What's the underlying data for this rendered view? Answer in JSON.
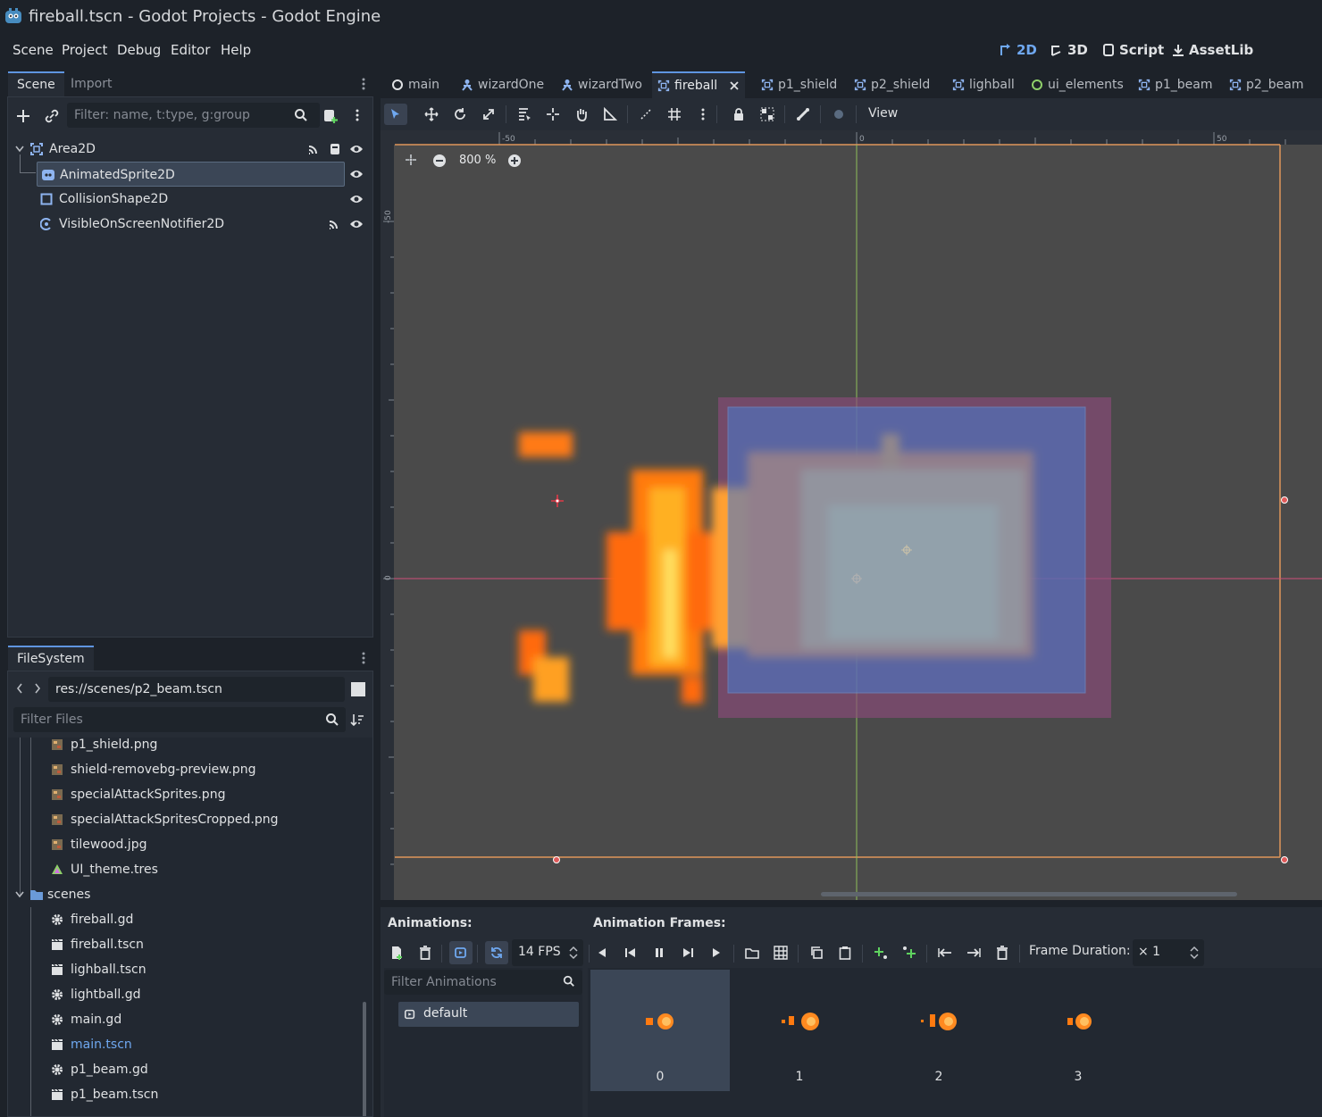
{
  "window": {
    "title": "fireball.tscn - Godot Projects - Godot Engine"
  },
  "menu": {
    "items": [
      "Scene",
      "Project",
      "Debug",
      "Editor",
      "Help"
    ]
  },
  "workspaces": {
    "2d": "2D",
    "3d": "3D",
    "script": "Script",
    "assetlib": "AssetLib"
  },
  "scene_dock": {
    "tabs": [
      "Scene",
      "Import"
    ],
    "filter_placeholder": "Filter: name, t:type, g:group",
    "nodes": [
      {
        "name": "Area2D",
        "icon": "area2d-icon",
        "signals": true,
        "script": true,
        "visible": true
      },
      {
        "name": "AnimatedSprite2D",
        "icon": "animatedsprite-icon",
        "selected": true,
        "visible": true
      },
      {
        "name": "CollisionShape2D",
        "icon": "collisionshape-icon",
        "visible": true
      },
      {
        "name": "VisibleOnScreenNotifier2D",
        "icon": "notifier-icon",
        "signals": true,
        "visible": true
      }
    ]
  },
  "filesystem": {
    "tab": "FileSystem",
    "path": "res://scenes/p2_beam.tscn",
    "filter_placeholder": "Filter Files",
    "items": [
      {
        "name": "p1_shield.png",
        "icon": "image-icon",
        "indent": 1
      },
      {
        "name": "shield-removebg-preview.png",
        "icon": "image-icon",
        "indent": 1
      },
      {
        "name": "specialAttackSprites.png",
        "icon": "image-icon",
        "indent": 1
      },
      {
        "name": "specialAttackSpritesCropped.png",
        "icon": "image-icon",
        "indent": 1
      },
      {
        "name": "tilewood.jpg",
        "icon": "image-icon",
        "indent": 1
      },
      {
        "name": "UI_theme.tres",
        "icon": "theme-icon",
        "indent": 1
      },
      {
        "name": "scenes",
        "icon": "folder-icon",
        "indent": 0
      },
      {
        "name": "fireball.gd",
        "icon": "script-gear-icon",
        "indent": 1
      },
      {
        "name": "fireball.tscn",
        "icon": "scene-file-icon",
        "indent": 1
      },
      {
        "name": "lighball.tscn",
        "icon": "scene-file-icon",
        "indent": 1
      },
      {
        "name": "lightball.gd",
        "icon": "script-gear-icon",
        "indent": 1
      },
      {
        "name": "main.gd",
        "icon": "script-gear-icon",
        "indent": 1
      },
      {
        "name": "main.tscn",
        "icon": "scene-file-icon",
        "indent": 1,
        "highlight": true
      },
      {
        "name": "p1_beam.gd",
        "icon": "script-gear-icon",
        "indent": 1
      },
      {
        "name": "p1_beam.tscn",
        "icon": "scene-file-icon",
        "indent": 1
      }
    ]
  },
  "scene_tabs": [
    {
      "label": "main",
      "icon": "node2d-icon"
    },
    {
      "label": "wizardOne",
      "icon": "character-icon"
    },
    {
      "label": "wizardTwo",
      "icon": "character-icon"
    },
    {
      "label": "fireball",
      "icon": "area2d-icon",
      "active": true
    },
    {
      "label": "p1_shield",
      "icon": "area2d-icon"
    },
    {
      "label": "p2_shield",
      "icon": "area2d-icon"
    },
    {
      "label": "lighball",
      "icon": "area2d-icon"
    },
    {
      "label": "ui_elements",
      "icon": "control-icon"
    },
    {
      "label": "p1_beam",
      "icon": "area2d-icon"
    },
    {
      "label": "p2_beam",
      "icon": "area2d-icon"
    }
  ],
  "toolbar": {
    "view_label": "View"
  },
  "viewport": {
    "zoom": "800 %",
    "ruler_labels": {
      "h_minus": "-50",
      "h_zero": "0",
      "h_plus": "50",
      "v_minus": "-50",
      "v_zero": "0"
    }
  },
  "animation_panel": {
    "animations_title": "Animations:",
    "frames_title": "Animation Frames:",
    "fps": "14 FPS",
    "frame_duration_label": "Frame Duration:",
    "frame_duration_value": "× 1",
    "filter_placeholder": "Filter Animations",
    "animations": [
      "default"
    ],
    "frames": [
      "0",
      "1",
      "2",
      "3"
    ]
  },
  "colors": {
    "accent": "#5f95e0",
    "background": "#1d2229",
    "panel": "#262c35",
    "viewport": "#4a4a4a",
    "selection": "#3b4656"
  }
}
